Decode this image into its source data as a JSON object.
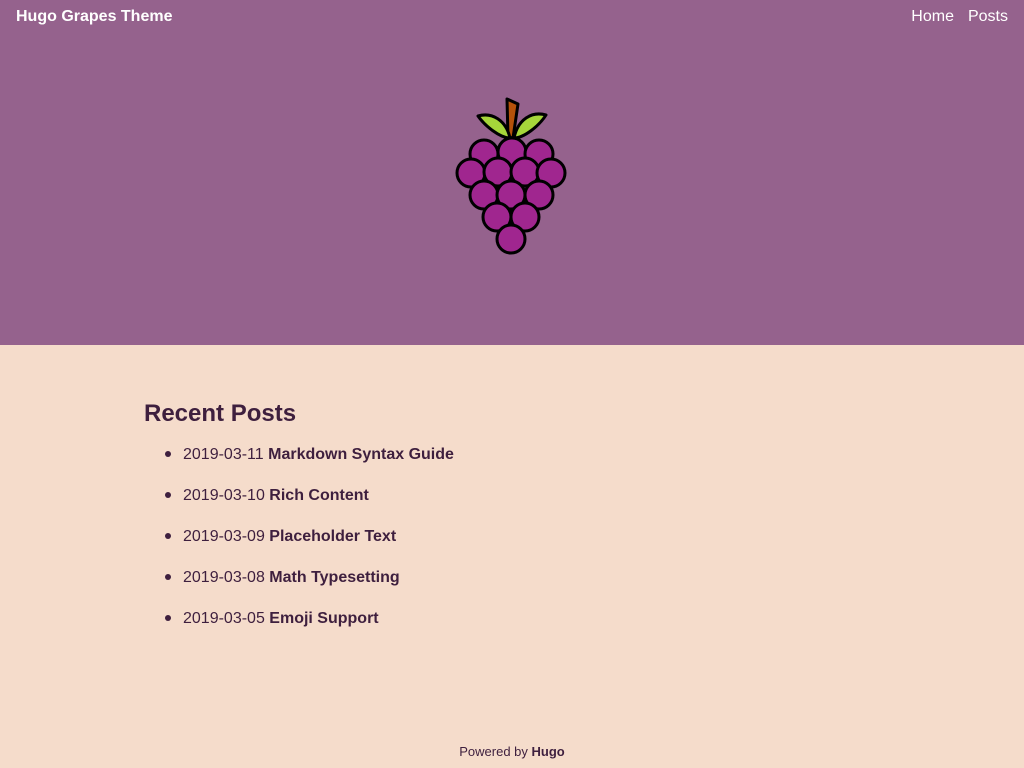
{
  "site": {
    "title": "Hugo Grapes Theme"
  },
  "nav": {
    "items": [
      {
        "label": "Home"
      },
      {
        "label": "Posts"
      }
    ]
  },
  "logo": {
    "icon": "grapes-icon",
    "colors": {
      "grape": "#a0268f",
      "leaf": "#a6d63a",
      "stem": "#b5520a",
      "outline": "#000000"
    }
  },
  "colors": {
    "header_bg": "#95628d",
    "page_bg": "#f5dccb",
    "text": "#3e1f3e"
  },
  "main": {
    "heading": "Recent Posts",
    "posts": [
      {
        "date": "2019-03-11",
        "title": "Markdown Syntax Guide"
      },
      {
        "date": "2019-03-10",
        "title": "Rich Content"
      },
      {
        "date": "2019-03-09",
        "title": "Placeholder Text"
      },
      {
        "date": "2019-03-08",
        "title": "Math Typesetting"
      },
      {
        "date": "2019-03-05",
        "title": "Emoji Support"
      }
    ]
  },
  "footer": {
    "prefix": "Powered by",
    "link_label": "Hugo"
  }
}
